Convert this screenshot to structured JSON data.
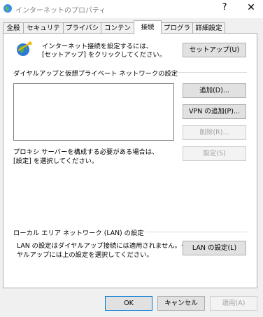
{
  "window": {
    "title": "インターネットのプロパティ",
    "help_glyph": "?",
    "close_glyph": "✕"
  },
  "tabs": [
    {
      "label": "全般"
    },
    {
      "label": "セキュリティ"
    },
    {
      "label": "プライバシー"
    },
    {
      "label": "コンテンツ"
    },
    {
      "label": "接続",
      "active": true
    },
    {
      "label": "プログラム"
    },
    {
      "label": "詳細設定"
    }
  ],
  "setup": {
    "text_line1": "インターネット接続を設定するには、",
    "text_line2": "[セットアップ] をクリックしてください。",
    "button": "セットアップ(U)"
  },
  "dialup": {
    "section_title": "ダイヤルアップと仮想プライベート ネットワークの設定",
    "add_button": "追加(D)...",
    "add_vpn_button": "VPN の追加(P)...",
    "remove_button": "削除(R)...",
    "settings_button": "設定(S)",
    "proxy_line1": "プロキシ サーバーを構成する必要がある場合は、",
    "proxy_line2": "[設定] を選択してください。"
  },
  "lan": {
    "section_title": "ローカル エリア ネットワーク (LAN) の設定",
    "text_line1": "LAN の設定はダイヤルアップ接続には適用されません。ダイ",
    "text_line2": "ヤルアップには上の設定を選択してください。",
    "button": "LAN の設定(L)"
  },
  "footer": {
    "ok": "OK",
    "cancel": "キャンセル",
    "apply": "適用(A)"
  },
  "colors": {
    "panel_bg": "#ffffff",
    "window_bg": "#f0f0f0",
    "button_bg": "#e1e1e1",
    "focus_border": "#0078d7"
  }
}
